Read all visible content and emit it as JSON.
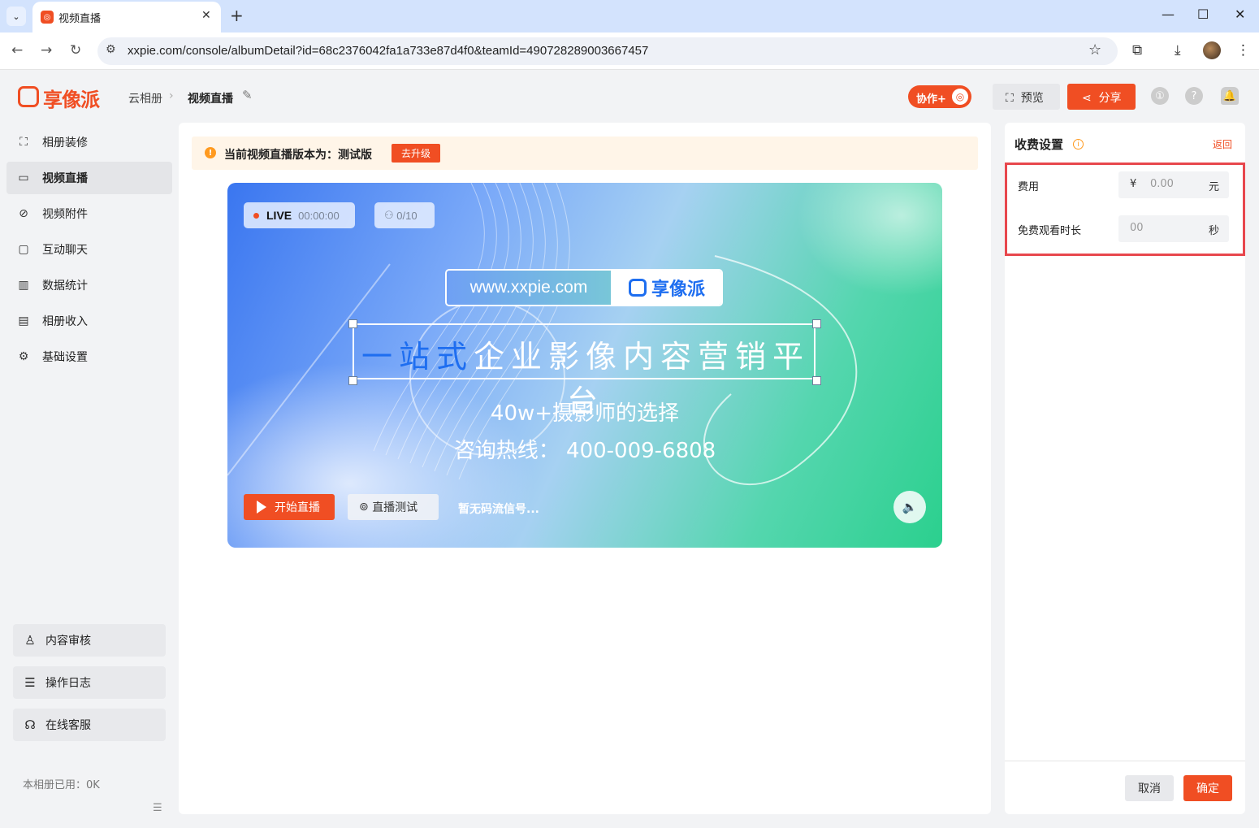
{
  "browser": {
    "tab_title": "视频直播",
    "url": "xxpie.com/console/albumDetail?id=68c2376042fa1a733e87d4f0&teamId=490728289003667457"
  },
  "header": {
    "logo_text": "享像派",
    "breadcrumb": [
      "云相册",
      "视频直播"
    ],
    "collab_label": "协作+",
    "preview_label": "预览",
    "share_label": "分享"
  },
  "sidebar": {
    "items": [
      {
        "label": "相册装修",
        "icon": "frame-icon",
        "active": false
      },
      {
        "label": "视频直播",
        "icon": "video-icon",
        "active": true
      },
      {
        "label": "视频附件",
        "icon": "paperclip-icon",
        "active": false
      },
      {
        "label": "互动聊天",
        "icon": "chat-icon",
        "active": false
      },
      {
        "label": "数据统计",
        "icon": "chart-icon",
        "active": false
      },
      {
        "label": "相册收入",
        "icon": "wallet-icon",
        "active": false
      },
      {
        "label": "基础设置",
        "icon": "gear-icon",
        "active": false
      }
    ],
    "bottom_items": [
      {
        "label": "内容审核",
        "icon": "stamp-icon"
      },
      {
        "label": "操作日志",
        "icon": "log-icon"
      },
      {
        "label": "在线客服",
        "icon": "headset-icon"
      }
    ],
    "usage": "本相册已用：0K"
  },
  "main": {
    "notice_text": "当前视频直播版本为：测试版",
    "upgrade_label": "去升级",
    "live_label": "LIVE",
    "live_time": "00:00:00",
    "viewers": "0/10",
    "brand_url": "www.xxpie.com",
    "brand_name": "享像派",
    "slogan_highlight": "一站式",
    "slogan_rest": "企业影像内容营销平台",
    "tagline": "40w+摄影师的选择",
    "hotline": "咨询热线：  400-009-6808",
    "start_label": "开始直播",
    "test_label": "直播测试",
    "status": "暂无码流信号..."
  },
  "fee_panel": {
    "title": "收费设置",
    "back_label": "返回",
    "fee_label": "费用",
    "fee_prefix": "¥",
    "fee_placeholder": "0.00",
    "fee_suffix": "元",
    "free_label": "免费观看时长",
    "free_placeholder": "00",
    "free_suffix": "秒",
    "cancel_label": "取消",
    "ok_label": "确定"
  },
  "colors": {
    "brand": "#f04e23",
    "highlight_border": "#e8474d",
    "notice_bg": "#fff5e8"
  }
}
